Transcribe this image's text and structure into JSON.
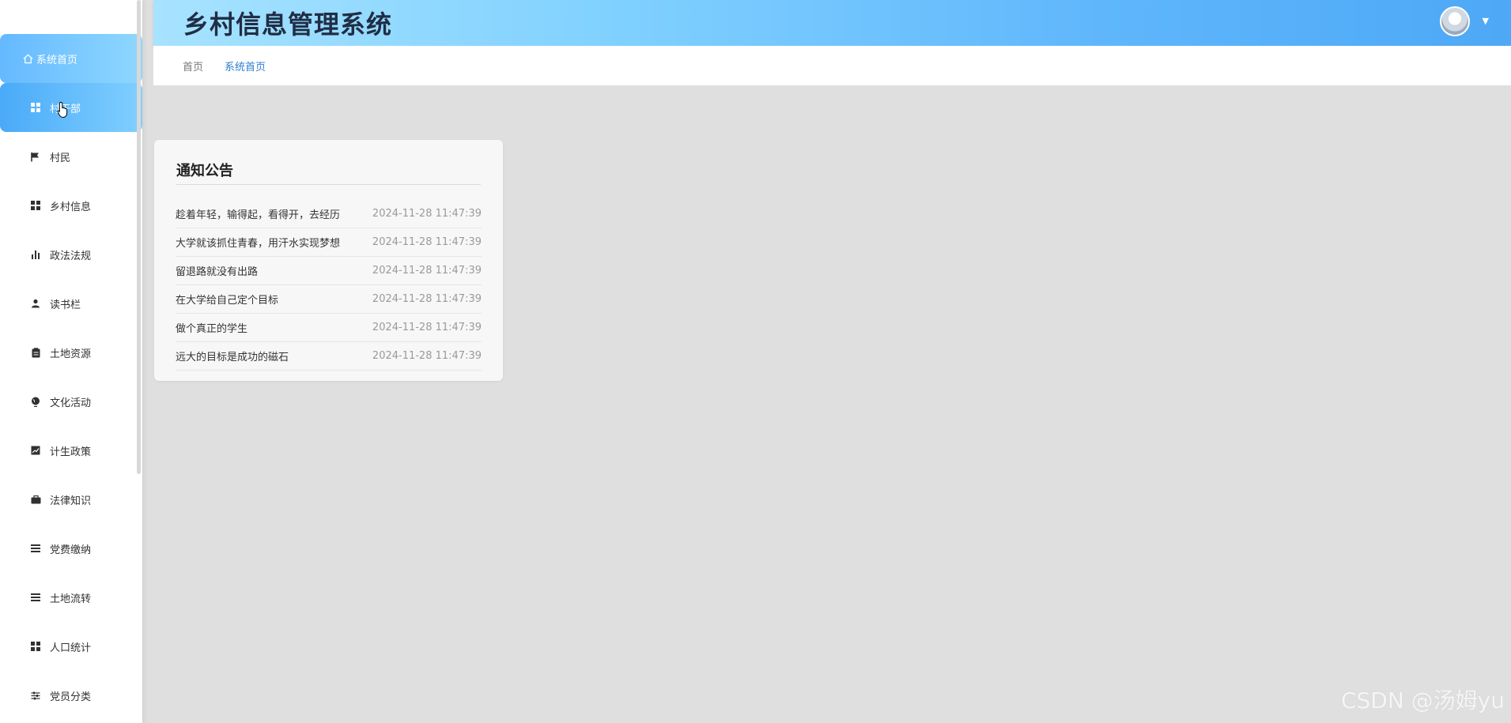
{
  "header": {
    "title": "乡村信息管理系统"
  },
  "breadcrumb": {
    "home": "首页",
    "current": "系统首页"
  },
  "sidebar": {
    "items": [
      {
        "label": "系统首页",
        "icon": "home-icon"
      },
      {
        "label": "村干部",
        "icon": "grid-icon"
      },
      {
        "label": "村民",
        "icon": "flag-icon"
      },
      {
        "label": "乡村信息",
        "icon": "grid-icon"
      },
      {
        "label": "政法法规",
        "icon": "bar-chart-icon"
      },
      {
        "label": "读书栏",
        "icon": "user-icon"
      },
      {
        "label": "土地资源",
        "icon": "clipboard-icon"
      },
      {
        "label": "文化活动",
        "icon": "globe-icon"
      },
      {
        "label": "计生政策",
        "icon": "line-chart-icon"
      },
      {
        "label": "法律知识",
        "icon": "briefcase-icon"
      },
      {
        "label": "党费缴纳",
        "icon": "list-icon"
      },
      {
        "label": "土地流转",
        "icon": "list-icon"
      },
      {
        "label": "人口统计",
        "icon": "grid-icon"
      },
      {
        "label": "党员分类",
        "icon": "sliders-icon"
      }
    ]
  },
  "notice": {
    "title": "通知公告",
    "items": [
      {
        "text": "趁着年轻，输得起，看得开，去经历",
        "date": "2024-11-28 11:47:39"
      },
      {
        "text": "大学就该抓住青春，用汗水实现梦想",
        "date": "2024-11-28 11:47:39"
      },
      {
        "text": "留退路就没有出路",
        "date": "2024-11-28 11:47:39"
      },
      {
        "text": "在大学给自己定个目标",
        "date": "2024-11-28 11:47:39"
      },
      {
        "text": "做个真正的学生",
        "date": "2024-11-28 11:47:39"
      },
      {
        "text": "远大的目标是成功的磁石",
        "date": "2024-11-28 11:47:39"
      }
    ]
  },
  "watermark": "CSDN @汤姆yu",
  "colors": {
    "accent": "#4ea8f6",
    "breadcrumb_active": "#2e7dd1"
  }
}
